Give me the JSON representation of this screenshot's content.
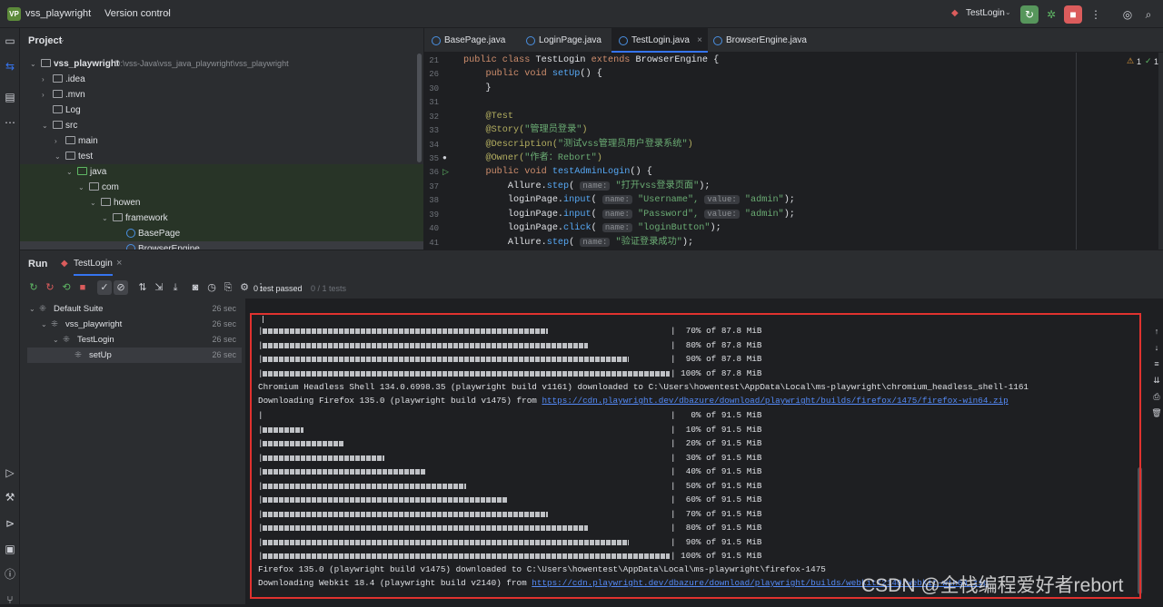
{
  "titlebar": {
    "project_badge": "VP",
    "project_name": "vss_playwright",
    "vcs_label": "Version control",
    "run_config": "TestLogin"
  },
  "sidebar_project": {
    "header": "Project",
    "items": [
      {
        "label": "vss_playwright",
        "path": "D:\\vss-Java\\vss_java_playwright\\vss_playwright"
      },
      {
        "label": ".idea"
      },
      {
        "label": ".mvn"
      },
      {
        "label": "Log"
      },
      {
        "label": "src"
      },
      {
        "label": "main"
      },
      {
        "label": "test"
      },
      {
        "label": "java"
      },
      {
        "label": "com"
      },
      {
        "label": "howen"
      },
      {
        "label": "framework"
      },
      {
        "label": "BasePage"
      },
      {
        "label": "BrowserEngine"
      }
    ]
  },
  "editor": {
    "tabs": [
      "BasePage.java",
      "LoginPage.java",
      "TestLogin.java",
      "BrowserEngine.java"
    ],
    "warnings": "1",
    "checks": "1",
    "line_numbers": [
      "21",
      "26",
      "30",
      "31",
      "32",
      "33",
      "34",
      "35",
      "36",
      "37",
      "38",
      "39",
      "40",
      "41"
    ],
    "lines": {
      "l1a": "public class ",
      "l1b": "TestLogin ",
      "l1c": "extends ",
      "l1d": "BrowserEngine {",
      "l2a": "    public void ",
      "l2b": "setUp",
      "l2c": "() {",
      "l3": "    }",
      "l5": "    @Test",
      "l6a": "    @Story(",
      "l6b": "\"管理员登录\"",
      "l6c": ")",
      "l7a": "    @Description(",
      "l7b": "\"测试vss管理员用户登录系统\"",
      "l7c": ")",
      "l8a": "    @Owner(",
      "l8b": "\"作者：Rebort\"",
      "l8c": ")",
      "l9a": "    public void ",
      "l9b": "testAdminLogin",
      "l9c": "() {",
      "l10a": "        Allure.",
      "l10b": "step",
      "l10c": "( ",
      "l10h": "name:",
      "l10d": " \"打开vss登录页面\"",
      "l10e": ");",
      "l11a": "        loginPage.",
      "l11b": "input",
      "l11c": "( ",
      "l11h1": "name:",
      "l11d": " \"Username\", ",
      "l11h2": "value:",
      "l11e": " \"admin\"",
      "l11f": ");",
      "l12a": "        loginPage.",
      "l12b": "input",
      "l12c": "( ",
      "l12h1": "name:",
      "l12d": " \"Password\", ",
      "l12h2": "value:",
      "l12e": " \"admin\"",
      "l12f": ");",
      "l13a": "        loginPage.",
      "l13b": "click",
      "l13c": "( ",
      "l13h": "name:",
      "l13d": " \"loginButton\"",
      "l13e": ");",
      "l14a": "        Allure.",
      "l14b": "step",
      "l14c": "( ",
      "l14h": "name:",
      "l14d": " \"验证登录成功\"",
      "l14e": ");"
    }
  },
  "run_panel": {
    "title": "Run",
    "tab": "TestLogin",
    "status": "0 test passed",
    "status_count": "0 / 1 tests",
    "tree": [
      {
        "label": "Default Suite",
        "duration": "26 sec"
      },
      {
        "label": "vss_playwright",
        "duration": "26 sec"
      },
      {
        "label": "TestLogin",
        "duration": "26 sec"
      },
      {
        "label": "setUp",
        "duration": "26 sec"
      }
    ]
  },
  "console": {
    "chromium_progress": [
      {
        "pct": "70%",
        "of": " of 87.8 MiB",
        "fill": 0.7
      },
      {
        "pct": "80%",
        "of": " of 87.8 MiB",
        "fill": 0.8
      },
      {
        "pct": "90%",
        "of": " of 87.8 MiB",
        "fill": 0.9
      },
      {
        "pct": "100%",
        "of": " of 87.8 MiB",
        "fill": 1.0
      }
    ],
    "chromium_done": "Chromium Headless Shell 134.0.6998.35 (playwright build v1161) downloaded to C:\\Users\\howentest\\AppData\\Local\\ms-playwright\\chromium_headless_shell-1161",
    "firefox_dl_prefix": "Downloading Firefox 135.0 (playwright build v1475) from ",
    "firefox_url": "https://cdn.playwright.dev/dbazure/download/playwright/builds/firefox/1475/firefox-win64.zip",
    "firefox_progress": [
      {
        "pct": "0%",
        "of": " of 91.5 MiB",
        "fill": 0.0
      },
      {
        "pct": "10%",
        "of": " of 91.5 MiB",
        "fill": 0.1
      },
      {
        "pct": "20%",
        "of": " of 91.5 MiB",
        "fill": 0.2
      },
      {
        "pct": "30%",
        "of": " of 91.5 MiB",
        "fill": 0.3
      },
      {
        "pct": "40%",
        "of": " of 91.5 MiB",
        "fill": 0.4
      },
      {
        "pct": "50%",
        "of": " of 91.5 MiB",
        "fill": 0.5
      },
      {
        "pct": "60%",
        "of": " of 91.5 MiB",
        "fill": 0.6
      },
      {
        "pct": "70%",
        "of": " of 91.5 MiB",
        "fill": 0.7
      },
      {
        "pct": "80%",
        "of": " of 91.5 MiB",
        "fill": 0.8
      },
      {
        "pct": "90%",
        "of": " of 91.5 MiB",
        "fill": 0.9
      },
      {
        "pct": "100%",
        "of": " of 91.5 MiB",
        "fill": 1.0
      }
    ],
    "firefox_done": "Firefox 135.0 (playwright build v1475) downloaded to C:\\Users\\howentest\\AppData\\Local\\ms-playwright\\firefox-1475",
    "webkit_dl_prefix": "Downloading Webkit 18.4 (playwright build v2140) from ",
    "webkit_url": "https://cdn.playwright.dev/dbazure/download/playwright/builds/webkit/2140/webkit-win64.zip"
  },
  "watermark": "CSDN @全栈编程爱好者rebort",
  "colors": {
    "accent": "#3574f0",
    "highlight_box": "#e0322f",
    "run_green": "#57965c",
    "stop_red": "#db5c5c"
  }
}
